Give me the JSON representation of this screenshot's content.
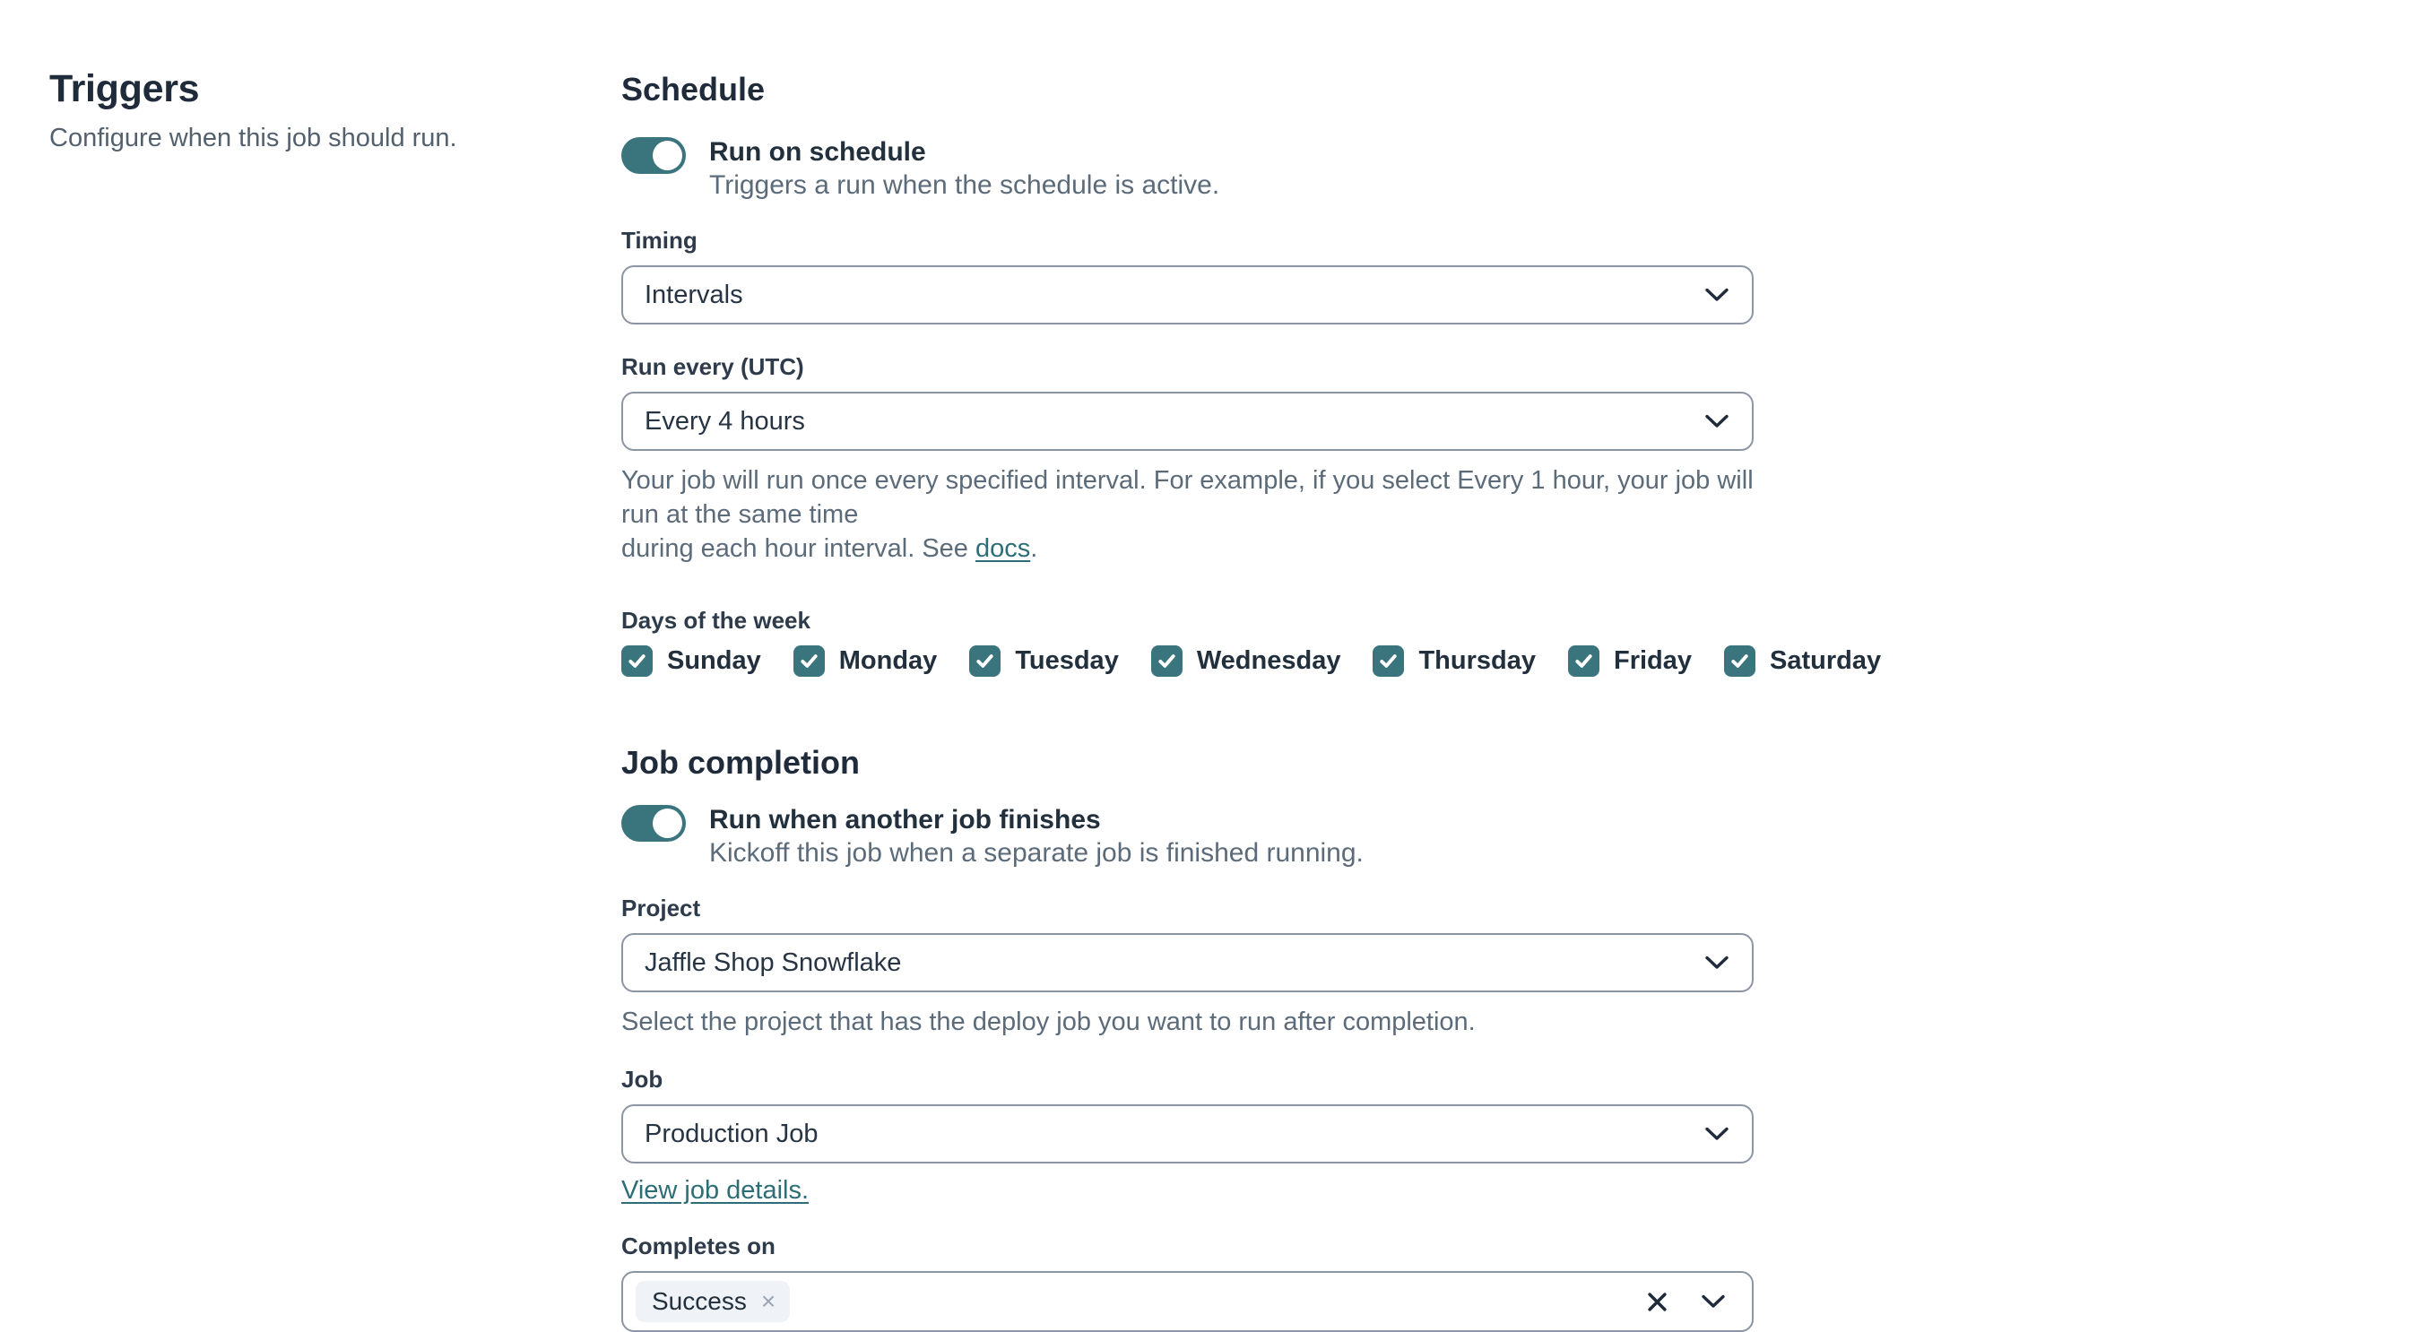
{
  "page": {
    "title": "Triggers",
    "subtitle": "Configure when this job should run."
  },
  "colors": {
    "accent_teal": "#3a757d",
    "link_teal": "#2d6e76",
    "heading_text": "#1f2b3a",
    "secondary_text": "#5c6b7a",
    "field_border": "#8b95a3",
    "chip_background": "#eff2f6"
  },
  "icons": {
    "checkmark": "✓",
    "chip_remove": "×",
    "clear": "×",
    "chevron_down": "∨"
  },
  "schedule": {
    "heading": "Schedule",
    "toggle": {
      "label": "Run on schedule",
      "description": "Triggers a run when the schedule is active.",
      "state_on": true
    },
    "timing": {
      "label": "Timing",
      "value": "Intervals"
    },
    "run_every": {
      "label": "Run every (UTC)",
      "value": "Every 4 hours"
    },
    "help": {
      "line1": "Your job will run once every specified interval. For example, if you select Every 1 hour, your job will run at the same time",
      "line2_prefix": "during each hour interval. See ",
      "link_label": "docs",
      "suffix": "."
    },
    "days": {
      "label": "Days of the week",
      "items": [
        {
          "label": "Sunday",
          "checked": true
        },
        {
          "label": "Monday",
          "checked": true
        },
        {
          "label": "Tuesday",
          "checked": true
        },
        {
          "label": "Wednesday",
          "checked": true
        },
        {
          "label": "Thursday",
          "checked": true
        },
        {
          "label": "Friday",
          "checked": true
        },
        {
          "label": "Saturday",
          "checked": true
        }
      ]
    }
  },
  "job_completion": {
    "heading": "Job completion",
    "toggle": {
      "label": "Run when another job finishes",
      "description": "Kickoff this job when a separate job is finished running.",
      "state_on": true
    },
    "project": {
      "label": "Project",
      "value": "Jaffle Shop Snowflake",
      "help": "Select the project that has the deploy job you want to run after completion."
    },
    "job": {
      "label": "Job",
      "value": "Production Job",
      "link_label": "View job details."
    },
    "completes_on": {
      "label": "Completes on",
      "chips": [
        {
          "label": "Success"
        }
      ]
    }
  }
}
